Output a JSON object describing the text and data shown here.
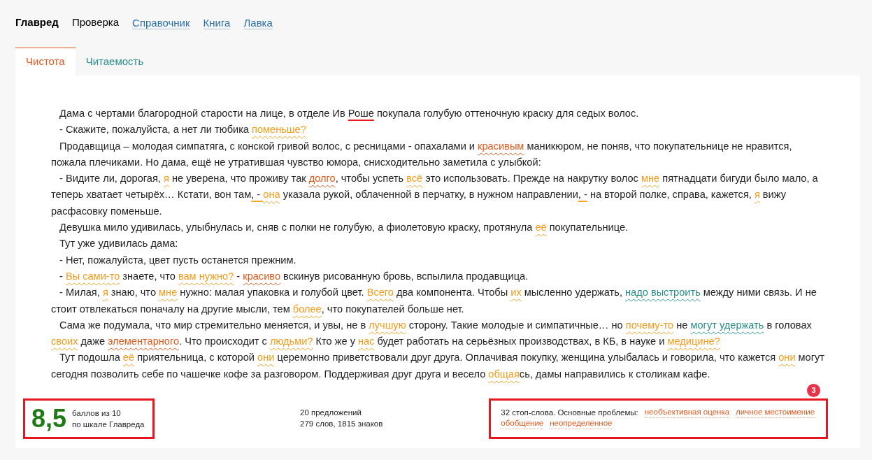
{
  "nav": [
    {
      "label": "Главред",
      "kind": "brand"
    },
    {
      "label": "Проверка",
      "kind": "current"
    },
    {
      "label": "Справочник",
      "kind": "link"
    },
    {
      "label": "Книга",
      "kind": "link"
    },
    {
      "label": "Лавка",
      "kind": "link"
    }
  ],
  "tabs": [
    {
      "label": "Чистота",
      "selected": true
    },
    {
      "label": "Читаемость",
      "selected": false
    }
  ],
  "paragraphs": [
    [
      {
        "text": "Дама с чертами благородной старости на лице, в отделе Ив ",
        "kind": "plain"
      },
      {
        "text": "Роше",
        "kind": "typo"
      },
      {
        "text": " покупала голубую оттеночную краску для седых волос.",
        "kind": "plain"
      }
    ],
    [
      {
        "text": "- Скажите, пожалуйста, а нет ли тюбика ",
        "kind": "plain"
      },
      {
        "text": "поменьше?",
        "kind": "stop"
      }
    ],
    [
      {
        "text": "Продавщица – молодая симпатяга, с конской гривой волос, с ресницами - опахалами и ",
        "kind": "plain"
      },
      {
        "text": "красивым",
        "kind": "strong"
      },
      {
        "text": " маникюром, не поняв, что покупательнице не нравится, пожала плечиками. Но дама, ещё не утратившая чувство юмора, снисходительно заметила с улыбкой:",
        "kind": "plain"
      }
    ],
    [
      {
        "text": "- Видите ли, дорогая, ",
        "kind": "plain"
      },
      {
        "text": "я",
        "kind": "stop"
      },
      {
        "text": " не уверена, что проживу так ",
        "kind": "plain"
      },
      {
        "text": "долго",
        "kind": "strong"
      },
      {
        "text": ", чтобы успеть ",
        "kind": "plain"
      },
      {
        "text": "всё",
        "kind": "stop"
      },
      {
        "text": " это использовать. Прежде на накрутку волос ",
        "kind": "plain"
      },
      {
        "text": "мне",
        "kind": "stop"
      },
      {
        "text": " пятнадцати бигуди было мало, а теперь хватает четырёх… Кстати, вон там",
        "kind": "plain"
      },
      {
        "text": ", - ",
        "kind": "punct"
      },
      {
        "text": "она",
        "kind": "stop"
      },
      {
        "text": " указала рукой, облаченной в перчатку, в нужном направлении",
        "kind": "plain"
      },
      {
        "text": ", -",
        "kind": "punct"
      },
      {
        "text": " на второй полке, справа, кажется, ",
        "kind": "plain"
      },
      {
        "text": "я",
        "kind": "stop"
      },
      {
        "text": " вижу расфасовку поменьше.",
        "kind": "plain"
      }
    ],
    [
      {
        "text": "Девушка мило удивилась, улыбнулась и, сняв с полки не голубую, а фиолетовую краску, протянула ",
        "kind": "plain"
      },
      {
        "text": "её",
        "kind": "stop"
      },
      {
        "text": " покупательнице.",
        "kind": "plain"
      }
    ],
    [
      {
        "text": "Тут уже удивилась дама:",
        "kind": "plain"
      }
    ],
    [
      {
        "text": "- Нет, пожалуйста, цвет пусть останется прежним.",
        "kind": "plain"
      }
    ],
    [
      {
        "text": "- ",
        "kind": "plain"
      },
      {
        "text": "Вы сами-то",
        "kind": "stop"
      },
      {
        "text": " знаете, что ",
        "kind": "plain"
      },
      {
        "text": "вам нужно?",
        "kind": "stop"
      },
      {
        "text": " - ",
        "kind": "plain"
      },
      {
        "text": "красиво",
        "kind": "strong"
      },
      {
        "text": " вскинув рисованную бровь, вспылила продавщица.",
        "kind": "plain"
      }
    ],
    [
      {
        "text": "- Милая, ",
        "kind": "plain"
      },
      {
        "text": "я",
        "kind": "stop"
      },
      {
        "text": " знаю, что ",
        "kind": "plain"
      },
      {
        "text": "мне",
        "kind": "stop"
      },
      {
        "text": " нужно: малая упаковка и голубой цвет. ",
        "kind": "plain"
      },
      {
        "text": "Всего",
        "kind": "stop"
      },
      {
        "text": " два компонента. Чтобы ",
        "kind": "plain"
      },
      {
        "text": "их",
        "kind": "stop"
      },
      {
        "text": " мысленно удержать, ",
        "kind": "plain"
      },
      {
        "text": "надо выстроить",
        "kind": "readability"
      },
      {
        "text": " между ними связь. И не стоит отвлекаться поначалу на другие мысли, тем ",
        "kind": "plain"
      },
      {
        "text": "более",
        "kind": "stop"
      },
      {
        "text": ", что покупателей больше нет.",
        "kind": "plain"
      }
    ],
    [
      {
        "text": "Сама же подумала, что мир стремительно меняется, и увы, не в ",
        "kind": "plain"
      },
      {
        "text": "лучшую",
        "kind": "stop"
      },
      {
        "text": " сторону. Такие молодые и симпатичные… но ",
        "kind": "plain"
      },
      {
        "text": "почему-то",
        "kind": "stop"
      },
      {
        "text": " не ",
        "kind": "plain"
      },
      {
        "text": "могут удержать",
        "kind": "readability"
      },
      {
        "text": " в головах ",
        "kind": "plain"
      },
      {
        "text": "своих",
        "kind": "stop"
      },
      {
        "text": " даже ",
        "kind": "plain"
      },
      {
        "text": "элементарного",
        "kind": "strong"
      },
      {
        "text": ". Что происходит с ",
        "kind": "plain"
      },
      {
        "text": "людьми?",
        "kind": "stop"
      },
      {
        "text": " Кто же у ",
        "kind": "plain"
      },
      {
        "text": "нас",
        "kind": "stop"
      },
      {
        "text": " будет работать на серьёзных производствах, в КБ, в науке и ",
        "kind": "plain"
      },
      {
        "text": "медицине?",
        "kind": "stop"
      }
    ],
    [
      {
        "text": "Тут подошла ",
        "kind": "plain"
      },
      {
        "text": "её",
        "kind": "stop"
      },
      {
        "text": " приятельница, с которой ",
        "kind": "plain"
      },
      {
        "text": "они",
        "kind": "stop"
      },
      {
        "text": " церемонно приветствовали друг друга. Оплачивая покупку, женщина улыбалась и говорила, что кажется ",
        "kind": "plain"
      },
      {
        "text": "они",
        "kind": "stop"
      },
      {
        "text": " могут сегодня позволить себе по чашечке кофе за разговором. Поддерживая друг друга и весело ",
        "kind": "plain"
      },
      {
        "text": "общая",
        "kind": "stop"
      },
      {
        "text": "сь, дамы направились к столикам кафе.",
        "kind": "plain"
      }
    ]
  ],
  "badge": "3",
  "score": {
    "value": "8,5",
    "label_1": "баллов из 10",
    "label_2": "по шкале Главреда"
  },
  "stats": [
    "20 предложений",
    "279 слов, 1815 знаков"
  ],
  "problems": {
    "summary": "32 стоп-слова. Основные проблемы:",
    "items": [
      "необъективная оценка",
      "личное местоимение",
      "обобщение",
      "неопределенное"
    ]
  }
}
